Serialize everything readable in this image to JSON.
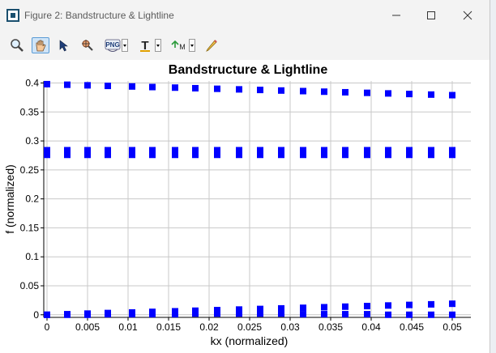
{
  "window": {
    "title": "Figure 2: Bandstructure & Lightline",
    "controls": [
      "minimize-icon",
      "maximize-icon",
      "close-icon"
    ]
  },
  "toolbar": {
    "tools": [
      "zoom-icon",
      "pan-hand-icon",
      "select-arrow-icon",
      "data-cursor-icon",
      "png-export-icon",
      "text-icon",
      "marker-icon",
      "pencil-icon"
    ],
    "png_label": "PNG",
    "text_label": "T",
    "marker_label": "M"
  },
  "colors": {
    "marker": "#0000ff",
    "grid": "#c8c8c8"
  },
  "chart_data": {
    "type": "scatter",
    "title": "Bandstructure & Lightline",
    "xlabel": "kx (normalized)",
    "ylabel": "f (normalized)",
    "xlim": [
      -0.0004,
      0.0523
    ],
    "ylim": [
      -0.0045,
      0.4035
    ],
    "xticks": [
      0,
      0.005,
      0.01,
      0.015,
      0.02,
      0.025,
      0.03,
      0.035,
      0.04,
      0.045,
      0.05
    ],
    "xtick_labels": [
      "0",
      "0.005",
      "0.01",
      "0.015",
      "0.02",
      "0.025",
      "0.03",
      "0.035",
      "0.04",
      "0.045",
      "0.05"
    ],
    "yticks": [
      0,
      0.05,
      0.1,
      0.15,
      0.2,
      0.25,
      0.3,
      0.35,
      0.4
    ],
    "ytick_labels": [
      "0",
      "0.05",
      "0.1",
      "0.15",
      "0.2",
      "0.25",
      "0.3",
      "0.35",
      "0.4"
    ],
    "grid": true,
    "marker": "square",
    "series": [
      {
        "x": [
          0,
          0.0025,
          0.005,
          0.0075,
          0.0105,
          0.013,
          0.0158,
          0.0183,
          0.021,
          0.0237,
          0.0263,
          0.0289,
          0.0316,
          0.0342,
          0.0368,
          0.0395,
          0.0421,
          0.0447,
          0.0474,
          0.05
        ],
        "y": [
          0.398,
          0.397,
          0.396,
          0.395,
          0.394,
          0.393,
          0.392,
          0.391,
          0.39,
          0.389,
          0.388,
          0.387,
          0.386,
          0.385,
          0.384,
          0.383,
          0.382,
          0.381,
          0.38,
          0.379
        ]
      },
      {
        "x": [
          0,
          0.0025,
          0.005,
          0.0075,
          0.0105,
          0.013,
          0.0158,
          0.0183,
          0.021,
          0.0237,
          0.0263,
          0.0289,
          0.0316,
          0.0342,
          0.0368,
          0.0395,
          0.0421,
          0.0447,
          0.0474,
          0.05
        ],
        "y": [
          0.284,
          0.284,
          0.284,
          0.284,
          0.284,
          0.284,
          0.284,
          0.284,
          0.284,
          0.284,
          0.284,
          0.284,
          0.284,
          0.284,
          0.284,
          0.284,
          0.284,
          0.284,
          0.284,
          0.284
        ]
      },
      {
        "x": [
          0,
          0.0025,
          0.005,
          0.0075,
          0.0105,
          0.013,
          0.0158,
          0.0183,
          0.021,
          0.0237,
          0.0263,
          0.0289,
          0.0316,
          0.0342,
          0.0368,
          0.0395,
          0.0421,
          0.0447,
          0.0474,
          0.05
        ],
        "y": [
          0.276,
          0.276,
          0.276,
          0.276,
          0.276,
          0.276,
          0.276,
          0.276,
          0.276,
          0.276,
          0.276,
          0.276,
          0.276,
          0.276,
          0.276,
          0.276,
          0.276,
          0.276,
          0.276,
          0.276
        ]
      },
      {
        "x": [
          0,
          0.0025,
          0.005,
          0.0075,
          0.0105,
          0.013,
          0.0158,
          0.0183,
          0.021,
          0.0237,
          0.0263,
          0.0289,
          0.0316,
          0.0342,
          0.0368,
          0.0395,
          0.0421,
          0.0447,
          0.0474,
          0.05
        ],
        "y": [
          0.0,
          0.001,
          0.002,
          0.003,
          0.004,
          0.005,
          0.006,
          0.007,
          0.008,
          0.009,
          0.01,
          0.011,
          0.012,
          0.013,
          0.014,
          0.015,
          0.016,
          0.017,
          0.018,
          0.019
        ]
      },
      {
        "x": [
          0,
          0.0025,
          0.005,
          0.0075,
          0.0105,
          0.013,
          0.0158,
          0.0183,
          0.021,
          0.0237,
          0.0263,
          0.0289,
          0.0316,
          0.0342,
          0.0368,
          0.0395,
          0.0421,
          0.0447,
          0.0474,
          0.05
        ],
        "y": [
          0.0,
          0.0,
          0.0,
          0.001,
          0.001,
          0.001,
          0.001,
          0.002,
          0.002,
          0.002,
          0.002,
          0.002,
          0.001,
          0.001,
          0.001,
          0.001,
          0.0,
          0.0,
          0.0,
          0.0
        ]
      }
    ]
  }
}
